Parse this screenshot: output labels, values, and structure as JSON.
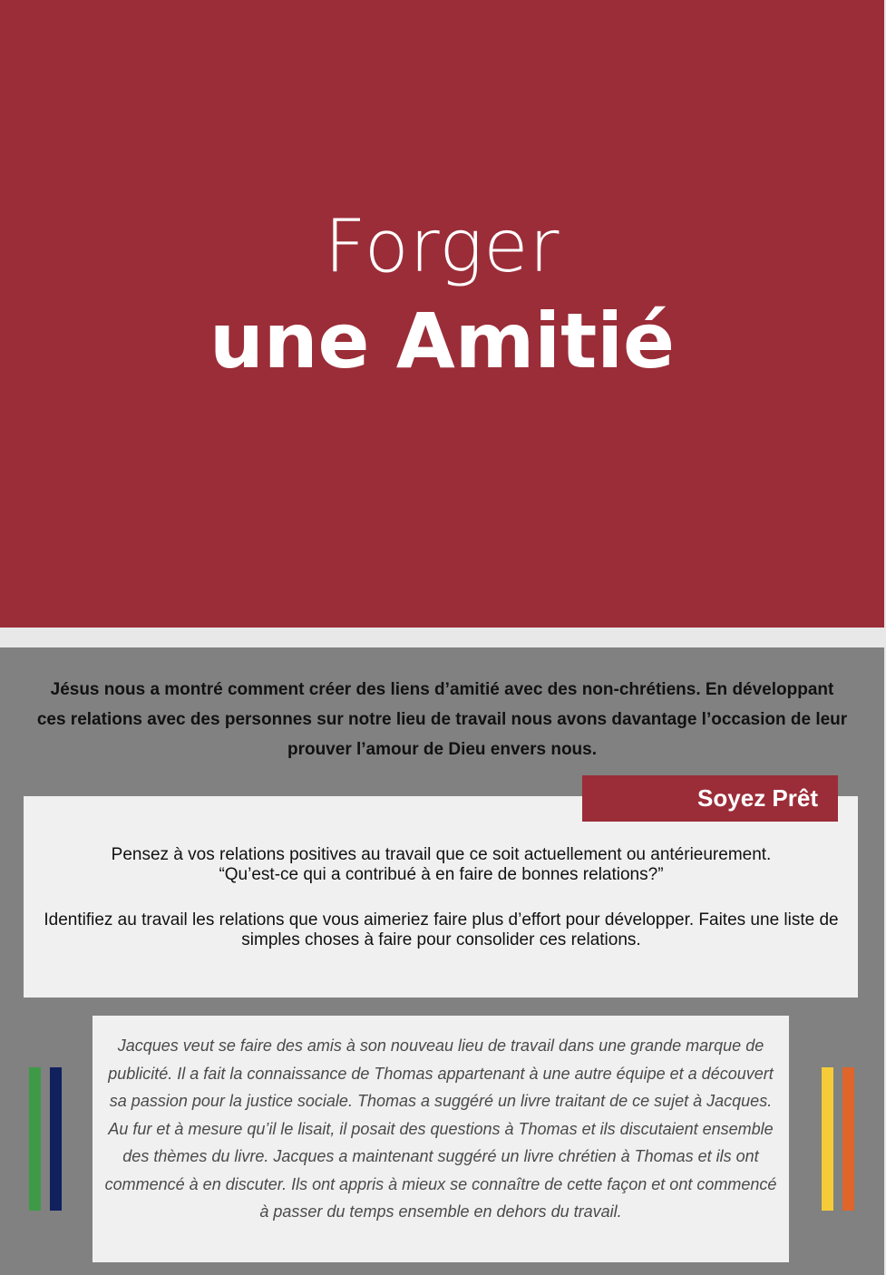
{
  "hero": {
    "title_line1": "Forger",
    "title_line2": "une Amitié",
    "background_color": "#9b2d38"
  },
  "intro": {
    "text": "Jésus nous a montré comment créer des liens d’amitié avec des non-chrétiens. En développant ces relations avec des personnes sur notre lieu de travail nous avons davantage l’occasion de leur prouver l’amour de Dieu envers nous."
  },
  "ready": {
    "label": "Soyez Prêt",
    "paragraph1_line1": "Pensez à vos relations positives au travail que ce soit actuellement ou antérieurement.",
    "paragraph1_line2": "“Qu’est-ce qui a contribué à en faire de bonnes relations?”",
    "paragraph2": "Identifiez au travail les relations que vous aimeriez faire plus d’effort pour développer. Faites une liste de simples choses à faire pour consolider ces relations."
  },
  "story": {
    "text": "Jacques veut se faire des amis à son nouveau lieu de travail dans une grande marque de publicité. Il a fait la connaissance de Thomas appartenant à une autre équipe et a découvert sa passion pour la justice sociale. Thomas a suggéré un livre traitant de ce sujet à Jacques. Au fur et à mesure qu’il le lisait, il posait des questions à Thomas et ils discutaient ensemble des thèmes du livre. Jacques a maintenant suggéré un livre chrétien à Thomas et ils ont commencé à en discuter. Ils ont appris à mieux se connaître de cette façon et ont commencé à passer du temps ensemble en dehors du travail."
  },
  "colors": {
    "accent": "#9b2d38",
    "panel": "#808180",
    "box": "#f0f0f0",
    "stripe_green": "#3f9a48",
    "stripe_navy": "#10215e",
    "stripe_yellow": "#f5cc38",
    "stripe_orange": "#e0652b"
  }
}
